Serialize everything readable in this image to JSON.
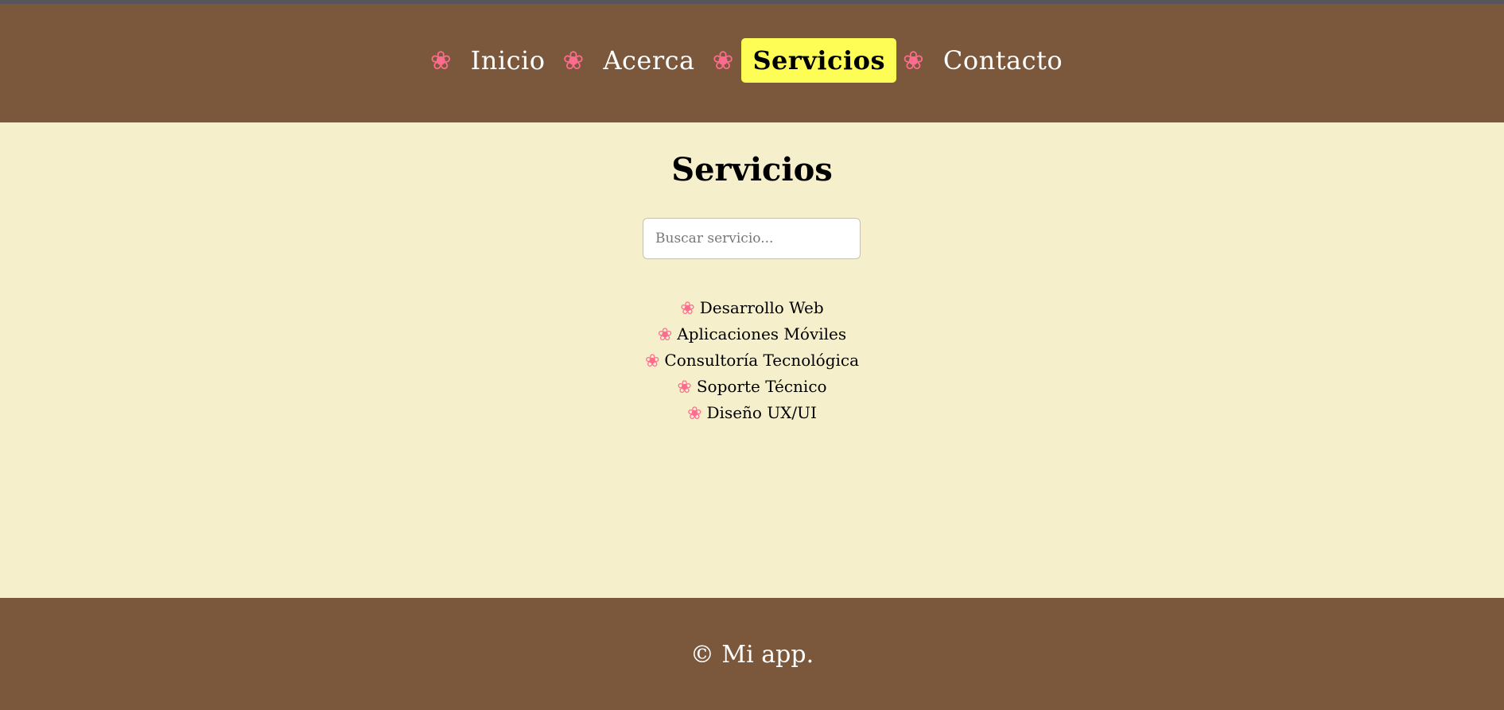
{
  "nav": {
    "items": [
      {
        "icon": "flower-icon",
        "label": "Inicio",
        "active": false
      },
      {
        "icon": "flower-icon",
        "label": "Acerca",
        "active": false
      },
      {
        "icon": "flower-icon",
        "label": "Servicios",
        "active": true
      },
      {
        "icon": "flower-icon",
        "label": "Contacto",
        "active": false
      }
    ],
    "flower_glyph": "❀"
  },
  "main": {
    "title": "Servicios",
    "search": {
      "placeholder": "Buscar servicio...",
      "value": ""
    },
    "services": [
      {
        "label": "Desarrollo Web"
      },
      {
        "label": "Aplicaciones Móviles"
      },
      {
        "label": "Consultoría Tecnológica"
      },
      {
        "label": "Soporte Técnico"
      },
      {
        "label": "Diseño UX/UI"
      }
    ]
  },
  "footer": {
    "text": "© Mi app."
  },
  "colors": {
    "header_bg": "#7b573c",
    "page_bg": "#f5efcb",
    "active_tab_bg": "#fdfd55",
    "flower": "#ff6b8e"
  }
}
